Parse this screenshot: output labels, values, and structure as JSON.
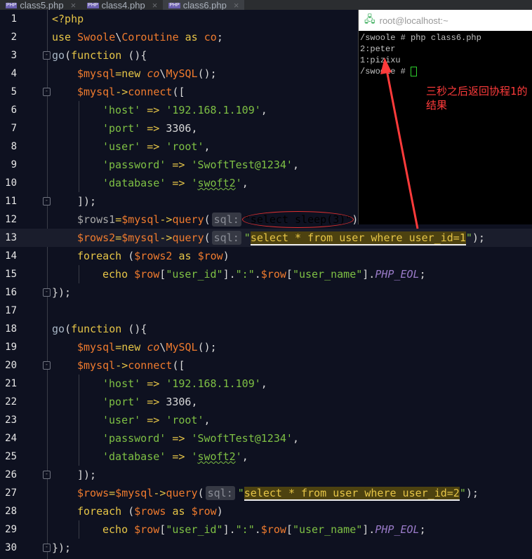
{
  "tabs": [
    {
      "label": "class5.php",
      "active": false
    },
    {
      "label": "class4.php",
      "active": false
    },
    {
      "label": "class6.php",
      "active": true
    }
  ],
  "terminal": {
    "title": "root@localhost:~",
    "lines": [
      "/swoole # php class6.php",
      "2:peter",
      "1:pizixu",
      "/swoole # "
    ]
  },
  "annotation": "三秒之后返回协程1的结果",
  "colors": {
    "background": "#0e1120",
    "keyword": "#e6c547",
    "variable": "#f07b2e",
    "string": "#7ec044",
    "annotation": "#ff3b3b"
  },
  "code": [
    {
      "n": "1",
      "t": [
        [
          "<?php",
          "k"
        ]
      ]
    },
    {
      "n": "2",
      "t": [
        [
          "use ",
          "k"
        ],
        [
          "Swoole",
          "c"
        ],
        [
          "\\",
          "p"
        ],
        [
          "Coroutine",
          "c"
        ],
        [
          " as ",
          "k"
        ],
        [
          "co",
          "c"
        ],
        [
          ";",
          "p"
        ]
      ]
    },
    {
      "n": "3",
      "fold": true,
      "t": [
        [
          "go",
          "g"
        ],
        [
          "(",
          "p"
        ],
        [
          "function ",
          "k"
        ],
        [
          "(){",
          "p"
        ]
      ]
    },
    {
      "n": "4",
      "ind": 1,
      "t": [
        [
          "$mysql",
          "v"
        ],
        [
          "=",
          "k"
        ],
        [
          "new ",
          "k"
        ],
        [
          "co",
          "ci"
        ],
        [
          "\\",
          "p"
        ],
        [
          "MySQL",
          "c"
        ],
        [
          "();",
          "p"
        ]
      ]
    },
    {
      "n": "5",
      "ind": 1,
      "fold": true,
      "t": [
        [
          "$mysql",
          "v"
        ],
        [
          "->",
          "k"
        ],
        [
          "connect",
          "v"
        ],
        [
          "([",
          "p"
        ]
      ]
    },
    {
      "n": "6",
      "ind": 2,
      "t": [
        [
          "'host'",
          "s"
        ],
        [
          " => ",
          "k"
        ],
        [
          "'192.168.1.109'",
          "s"
        ],
        [
          ",",
          "p"
        ]
      ]
    },
    {
      "n": "7",
      "ind": 2,
      "t": [
        [
          "'port'",
          "s"
        ],
        [
          " => ",
          "k"
        ],
        [
          "3306",
          "p"
        ],
        [
          ",",
          "p"
        ]
      ]
    },
    {
      "n": "8",
      "ind": 2,
      "t": [
        [
          "'user'",
          "s"
        ],
        [
          " => ",
          "k"
        ],
        [
          "'root'",
          "s"
        ],
        [
          ",",
          "p"
        ]
      ]
    },
    {
      "n": "9",
      "ind": 2,
      "t": [
        [
          "'password'",
          "s"
        ],
        [
          " => ",
          "k"
        ],
        [
          "'SwoftTest@1234'",
          "s"
        ],
        [
          ",",
          "p"
        ]
      ]
    },
    {
      "n": "10",
      "ind": 2,
      "t": [
        [
          "'database'",
          "s"
        ],
        [
          " => ",
          "k"
        ],
        [
          "'",
          "s"
        ],
        [
          "swoft2",
          "sw"
        ],
        [
          "'",
          "s"
        ],
        [
          ",",
          "p"
        ]
      ]
    },
    {
      "n": "11",
      "ind": 1,
      "fold": true,
      "t": [
        [
          "]);",
          "p"
        ]
      ]
    },
    {
      "n": "12",
      "ind": 1,
      "t": [
        [
          "$rows1",
          "dv"
        ],
        [
          "=",
          "k"
        ],
        [
          "$mysql",
          "v"
        ],
        [
          "->",
          "k"
        ],
        [
          "query",
          "v"
        ],
        [
          "(",
          "p"
        ],
        [
          "sql:",
          "badge"
        ],
        [
          "\"select sleep(3)\"",
          "ell"
        ],
        [
          ");",
          "p"
        ]
      ]
    },
    {
      "n": "13",
      "ind": 1,
      "hl": true,
      "t": [
        [
          "$rows2",
          "v"
        ],
        [
          "=",
          "k"
        ],
        [
          "$mysql",
          "v"
        ],
        [
          "->",
          "k"
        ],
        [
          "query",
          "v"
        ],
        [
          "(",
          "p"
        ],
        [
          "sql:",
          "badge"
        ],
        [
          "\"",
          "s"
        ],
        [
          "select * from user where user_id=1",
          "hls"
        ],
        [
          "\"",
          "s"
        ],
        [
          ");",
          "p"
        ]
      ]
    },
    {
      "n": "14",
      "ind": 1,
      "t": [
        [
          "foreach ",
          "k"
        ],
        [
          "(",
          "p"
        ],
        [
          "$rows2",
          "v"
        ],
        [
          " as ",
          "k"
        ],
        [
          "$row",
          "v"
        ],
        [
          ")",
          "p"
        ]
      ]
    },
    {
      "n": "15",
      "ind": 2,
      "t": [
        [
          "echo ",
          "k"
        ],
        [
          "$row",
          "v"
        ],
        [
          "[",
          "p"
        ],
        [
          "\"user_id\"",
          "s"
        ],
        [
          "].",
          "p"
        ],
        [
          "\":\"",
          "s"
        ],
        [
          ".",
          "p"
        ],
        [
          "$row",
          "v"
        ],
        [
          "[",
          "p"
        ],
        [
          "\"user_name\"",
          "s"
        ],
        [
          "].",
          "p"
        ],
        [
          "PHP_EOL",
          "i"
        ],
        [
          ";",
          "p"
        ]
      ]
    },
    {
      "n": "16",
      "fold": true,
      "t": [
        [
          "});",
          "p"
        ]
      ]
    },
    {
      "n": "17",
      "t": []
    },
    {
      "n": "18",
      "t": [
        [
          "go",
          "g"
        ],
        [
          "(",
          "p"
        ],
        [
          "function ",
          "k"
        ],
        [
          "(){",
          "p"
        ]
      ]
    },
    {
      "n": "19",
      "ind": 1,
      "t": [
        [
          "$mysql",
          "v"
        ],
        [
          "=",
          "k"
        ],
        [
          "new ",
          "k"
        ],
        [
          "co",
          "ci"
        ],
        [
          "\\",
          "p"
        ],
        [
          "MySQL",
          "c"
        ],
        [
          "();",
          "p"
        ]
      ]
    },
    {
      "n": "20",
      "ind": 1,
      "fold": true,
      "t": [
        [
          "$mysql",
          "v"
        ],
        [
          "->",
          "k"
        ],
        [
          "connect",
          "v"
        ],
        [
          "([",
          "p"
        ]
      ]
    },
    {
      "n": "21",
      "ind": 2,
      "t": [
        [
          "'host'",
          "s"
        ],
        [
          " => ",
          "k"
        ],
        [
          "'192.168.1.109'",
          "s"
        ],
        [
          ",",
          "p"
        ]
      ]
    },
    {
      "n": "22",
      "ind": 2,
      "t": [
        [
          "'port'",
          "s"
        ],
        [
          " => ",
          "k"
        ],
        [
          "3306",
          "p"
        ],
        [
          ",",
          "p"
        ]
      ]
    },
    {
      "n": "23",
      "ind": 2,
      "t": [
        [
          "'user'",
          "s"
        ],
        [
          " => ",
          "k"
        ],
        [
          "'root'",
          "s"
        ],
        [
          ",",
          "p"
        ]
      ]
    },
    {
      "n": "24",
      "ind": 2,
      "t": [
        [
          "'password'",
          "s"
        ],
        [
          " => ",
          "k"
        ],
        [
          "'SwoftTest@1234'",
          "s"
        ],
        [
          ",",
          "p"
        ]
      ]
    },
    {
      "n": "25",
      "ind": 2,
      "t": [
        [
          "'database'",
          "s"
        ],
        [
          " => ",
          "k"
        ],
        [
          "'",
          "s"
        ],
        [
          "swoft2",
          "sw"
        ],
        [
          "'",
          "s"
        ],
        [
          ",",
          "p"
        ]
      ]
    },
    {
      "n": "26",
      "ind": 1,
      "fold": true,
      "t": [
        [
          "]);",
          "p"
        ]
      ]
    },
    {
      "n": "27",
      "ind": 1,
      "t": [
        [
          "$rows",
          "v"
        ],
        [
          "=",
          "k"
        ],
        [
          "$mysql",
          "v"
        ],
        [
          "->",
          "k"
        ],
        [
          "query",
          "v"
        ],
        [
          "(",
          "p"
        ],
        [
          "sql:",
          "badge"
        ],
        [
          "\"",
          "s"
        ],
        [
          "select * from user where user_id=2",
          "hls"
        ],
        [
          "\"",
          "s"
        ],
        [
          ");",
          "p"
        ]
      ]
    },
    {
      "n": "28",
      "ind": 1,
      "t": [
        [
          "foreach ",
          "k"
        ],
        [
          "(",
          "p"
        ],
        [
          "$rows",
          "v"
        ],
        [
          " as ",
          "k"
        ],
        [
          "$row",
          "v"
        ],
        [
          ")",
          "p"
        ]
      ]
    },
    {
      "n": "29",
      "ind": 2,
      "t": [
        [
          "echo ",
          "k"
        ],
        [
          "$row",
          "v"
        ],
        [
          "[",
          "p"
        ],
        [
          "\"user_id\"",
          "s"
        ],
        [
          "].",
          "p"
        ],
        [
          "\":\"",
          "s"
        ],
        [
          ".",
          "p"
        ],
        [
          "$row",
          "v"
        ],
        [
          "[",
          "p"
        ],
        [
          "\"user_name\"",
          "s"
        ],
        [
          "].",
          "p"
        ],
        [
          "PHP_EOL",
          "i"
        ],
        [
          ";",
          "p"
        ]
      ]
    },
    {
      "n": "30",
      "fold": true,
      "t": [
        [
          "});",
          "p"
        ]
      ]
    }
  ]
}
